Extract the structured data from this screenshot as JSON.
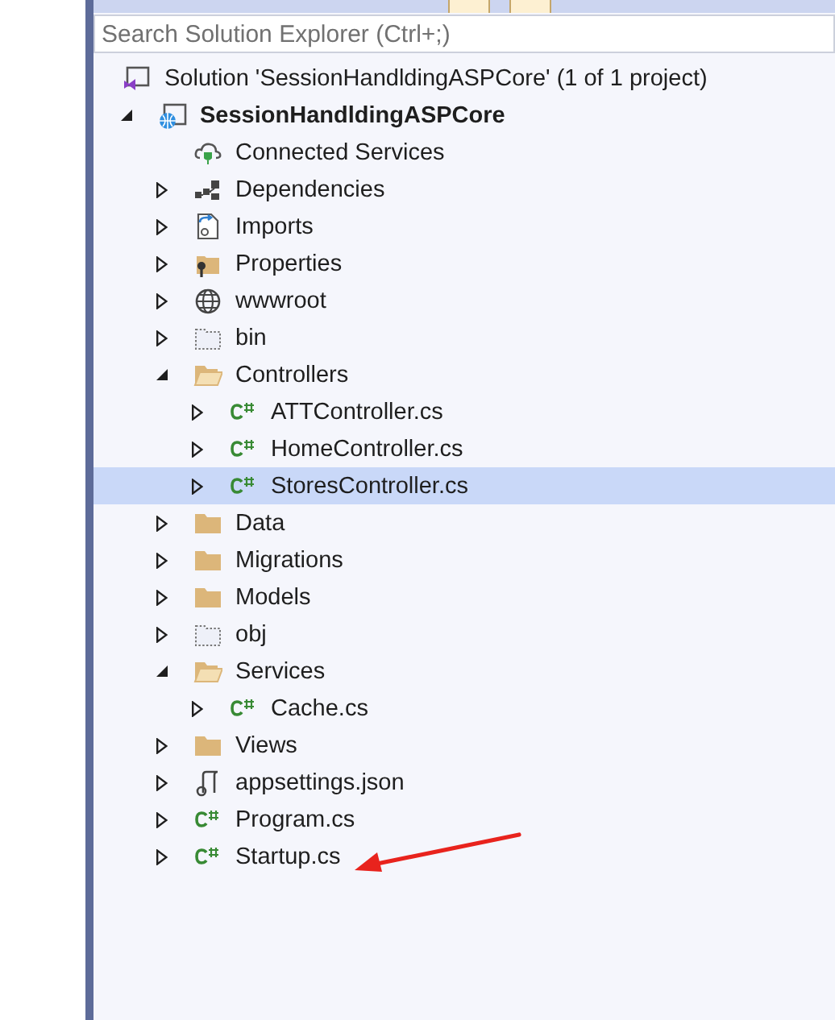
{
  "toolbar": {
    "buttons": [
      {
        "selected": true
      },
      {
        "selected": true
      }
    ]
  },
  "search": {
    "placeholder": "Search Solution Explorer (Ctrl+;)"
  },
  "tree": {
    "label": "Solution 'SessionHandldingASPCore' (1 of 1 project)",
    "kind": "solution",
    "children": [
      {
        "label": "SessionHandldingASPCore",
        "kind": "web-project",
        "bold": true,
        "expanded": true,
        "selected": false,
        "children": [
          {
            "label": "Connected Services",
            "kind": "connected",
            "selected": false
          },
          {
            "label": "Dependencies",
            "kind": "dependencies",
            "expanded": false,
            "selected": false
          },
          {
            "label": "Imports",
            "kind": "imports",
            "expanded": false,
            "selected": false
          },
          {
            "label": "Properties",
            "kind": "properties",
            "expanded": false,
            "selected": false
          },
          {
            "label": "wwwroot",
            "kind": "globe",
            "expanded": false,
            "selected": false
          },
          {
            "label": "bin",
            "kind": "dotted-folder",
            "expanded": false,
            "selected": false
          },
          {
            "label": "Controllers",
            "kind": "folder",
            "expanded": true,
            "selected": false,
            "children": [
              {
                "label": "ATTController.cs",
                "kind": "csharp",
                "expanded": false,
                "selected": false
              },
              {
                "label": "HomeController.cs",
                "kind": "csharp",
                "expanded": false,
                "selected": false
              },
              {
                "label": "StoresController.cs",
                "kind": "csharp",
                "expanded": false,
                "selected": true
              }
            ]
          },
          {
            "label": "Data",
            "kind": "folder",
            "expanded": false,
            "selected": false
          },
          {
            "label": "Migrations",
            "kind": "folder",
            "expanded": false,
            "selected": false
          },
          {
            "label": "Models",
            "kind": "folder",
            "expanded": false,
            "selected": false
          },
          {
            "label": "obj",
            "kind": "dotted-folder",
            "expanded": false,
            "selected": false
          },
          {
            "label": "Services",
            "kind": "folder",
            "expanded": true,
            "selected": false,
            "children": [
              {
                "label": "Cache.cs",
                "kind": "csharp",
                "expanded": false,
                "selected": false
              }
            ]
          },
          {
            "label": "Views",
            "kind": "folder",
            "expanded": false,
            "selected": false
          },
          {
            "label": "appsettings.json",
            "kind": "json",
            "expanded": false,
            "selected": false
          },
          {
            "label": "Program.cs",
            "kind": "csharp",
            "expanded": false,
            "selected": false
          },
          {
            "label": "Startup.cs",
            "kind": "csharp",
            "expanded": false,
            "selected": false
          }
        ]
      }
    ]
  },
  "annotation": {
    "kind": "arrow"
  }
}
